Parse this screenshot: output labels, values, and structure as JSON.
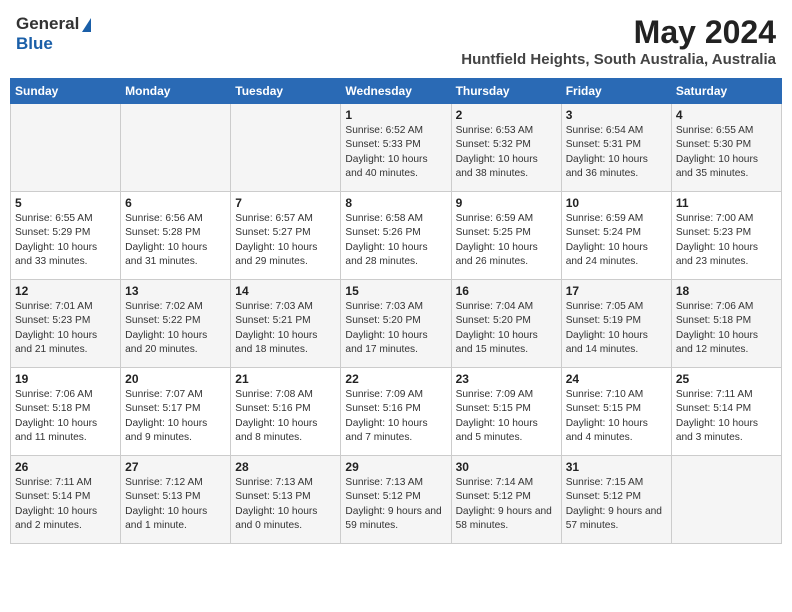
{
  "header": {
    "logo_general": "General",
    "logo_blue": "Blue",
    "month": "May 2024",
    "location": "Huntfield Heights, South Australia, Australia"
  },
  "days_of_week": [
    "Sunday",
    "Monday",
    "Tuesday",
    "Wednesday",
    "Thursday",
    "Friday",
    "Saturday"
  ],
  "weeks": [
    [
      {
        "day": "",
        "info": ""
      },
      {
        "day": "",
        "info": ""
      },
      {
        "day": "",
        "info": ""
      },
      {
        "day": "1",
        "info": "Sunrise: 6:52 AM\nSunset: 5:33 PM\nDaylight: 10 hours\nand 40 minutes."
      },
      {
        "day": "2",
        "info": "Sunrise: 6:53 AM\nSunset: 5:32 PM\nDaylight: 10 hours\nand 38 minutes."
      },
      {
        "day": "3",
        "info": "Sunrise: 6:54 AM\nSunset: 5:31 PM\nDaylight: 10 hours\nand 36 minutes."
      },
      {
        "day": "4",
        "info": "Sunrise: 6:55 AM\nSunset: 5:30 PM\nDaylight: 10 hours\nand 35 minutes."
      }
    ],
    [
      {
        "day": "5",
        "info": "Sunrise: 6:55 AM\nSunset: 5:29 PM\nDaylight: 10 hours\nand 33 minutes."
      },
      {
        "day": "6",
        "info": "Sunrise: 6:56 AM\nSunset: 5:28 PM\nDaylight: 10 hours\nand 31 minutes."
      },
      {
        "day": "7",
        "info": "Sunrise: 6:57 AM\nSunset: 5:27 PM\nDaylight: 10 hours\nand 29 minutes."
      },
      {
        "day": "8",
        "info": "Sunrise: 6:58 AM\nSunset: 5:26 PM\nDaylight: 10 hours\nand 28 minutes."
      },
      {
        "day": "9",
        "info": "Sunrise: 6:59 AM\nSunset: 5:25 PM\nDaylight: 10 hours\nand 26 minutes."
      },
      {
        "day": "10",
        "info": "Sunrise: 6:59 AM\nSunset: 5:24 PM\nDaylight: 10 hours\nand 24 minutes."
      },
      {
        "day": "11",
        "info": "Sunrise: 7:00 AM\nSunset: 5:23 PM\nDaylight: 10 hours\nand 23 minutes."
      }
    ],
    [
      {
        "day": "12",
        "info": "Sunrise: 7:01 AM\nSunset: 5:23 PM\nDaylight: 10 hours\nand 21 minutes."
      },
      {
        "day": "13",
        "info": "Sunrise: 7:02 AM\nSunset: 5:22 PM\nDaylight: 10 hours\nand 20 minutes."
      },
      {
        "day": "14",
        "info": "Sunrise: 7:03 AM\nSunset: 5:21 PM\nDaylight: 10 hours\nand 18 minutes."
      },
      {
        "day": "15",
        "info": "Sunrise: 7:03 AM\nSunset: 5:20 PM\nDaylight: 10 hours\nand 17 minutes."
      },
      {
        "day": "16",
        "info": "Sunrise: 7:04 AM\nSunset: 5:20 PM\nDaylight: 10 hours\nand 15 minutes."
      },
      {
        "day": "17",
        "info": "Sunrise: 7:05 AM\nSunset: 5:19 PM\nDaylight: 10 hours\nand 14 minutes."
      },
      {
        "day": "18",
        "info": "Sunrise: 7:06 AM\nSunset: 5:18 PM\nDaylight: 10 hours\nand 12 minutes."
      }
    ],
    [
      {
        "day": "19",
        "info": "Sunrise: 7:06 AM\nSunset: 5:18 PM\nDaylight: 10 hours\nand 11 minutes."
      },
      {
        "day": "20",
        "info": "Sunrise: 7:07 AM\nSunset: 5:17 PM\nDaylight: 10 hours\nand 9 minutes."
      },
      {
        "day": "21",
        "info": "Sunrise: 7:08 AM\nSunset: 5:16 PM\nDaylight: 10 hours\nand 8 minutes."
      },
      {
        "day": "22",
        "info": "Sunrise: 7:09 AM\nSunset: 5:16 PM\nDaylight: 10 hours\nand 7 minutes."
      },
      {
        "day": "23",
        "info": "Sunrise: 7:09 AM\nSunset: 5:15 PM\nDaylight: 10 hours\nand 5 minutes."
      },
      {
        "day": "24",
        "info": "Sunrise: 7:10 AM\nSunset: 5:15 PM\nDaylight: 10 hours\nand 4 minutes."
      },
      {
        "day": "25",
        "info": "Sunrise: 7:11 AM\nSunset: 5:14 PM\nDaylight: 10 hours\nand 3 minutes."
      }
    ],
    [
      {
        "day": "26",
        "info": "Sunrise: 7:11 AM\nSunset: 5:14 PM\nDaylight: 10 hours\nand 2 minutes."
      },
      {
        "day": "27",
        "info": "Sunrise: 7:12 AM\nSunset: 5:13 PM\nDaylight: 10 hours\nand 1 minute."
      },
      {
        "day": "28",
        "info": "Sunrise: 7:13 AM\nSunset: 5:13 PM\nDaylight: 10 hours\nand 0 minutes."
      },
      {
        "day": "29",
        "info": "Sunrise: 7:13 AM\nSunset: 5:12 PM\nDaylight: 9 hours\nand 59 minutes."
      },
      {
        "day": "30",
        "info": "Sunrise: 7:14 AM\nSunset: 5:12 PM\nDaylight: 9 hours\nand 58 minutes."
      },
      {
        "day": "31",
        "info": "Sunrise: 7:15 AM\nSunset: 5:12 PM\nDaylight: 9 hours\nand 57 minutes."
      },
      {
        "day": "",
        "info": ""
      }
    ]
  ]
}
